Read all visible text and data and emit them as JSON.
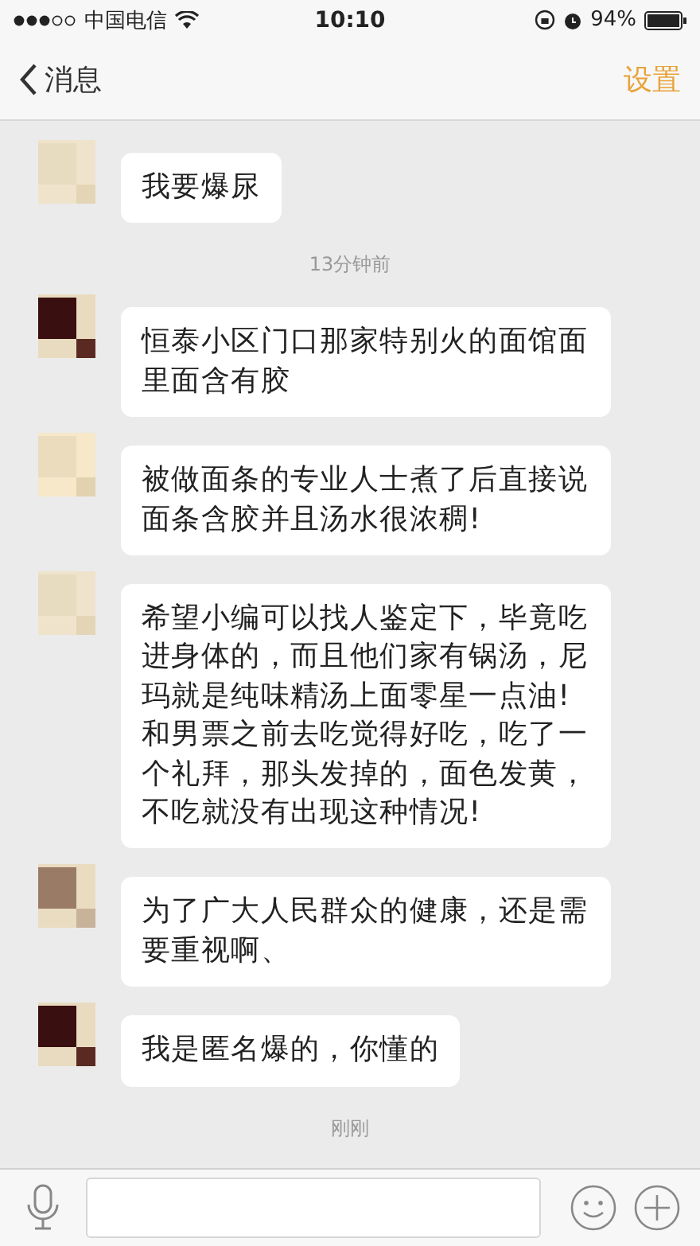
{
  "status_bar": {
    "carrier": "中国电信",
    "time": "10:10",
    "battery": "94%"
  },
  "nav": {
    "back": "消息",
    "action": "设置"
  },
  "messages": [
    {
      "kind": "message",
      "text": "我要爆尿"
    },
    {
      "kind": "time",
      "text": "13分钟前"
    },
    {
      "kind": "message",
      "text": "恒泰小区门口那家特别火的面馆面里面含有胶"
    },
    {
      "kind": "message",
      "text": "被做面条的专业人士煮了后直接说面条含胶并且汤水很浓稠!"
    },
    {
      "kind": "message",
      "text": "希望小编可以找人鉴定下，毕竟吃进身体的，而且他们家有锅汤，尼玛就是纯味精汤上面零星一点油!和男票之前去吃觉得好吃，吃了一个礼拜，那头发掉的，面色发黄，不吃就没有出现这种情况!"
    },
    {
      "kind": "message",
      "text": "为了广大人民群众的健康，还是需要重视啊、"
    },
    {
      "kind": "message",
      "text": "我是匿名爆的，你懂的"
    },
    {
      "kind": "time",
      "text": "刚刚"
    }
  ]
}
